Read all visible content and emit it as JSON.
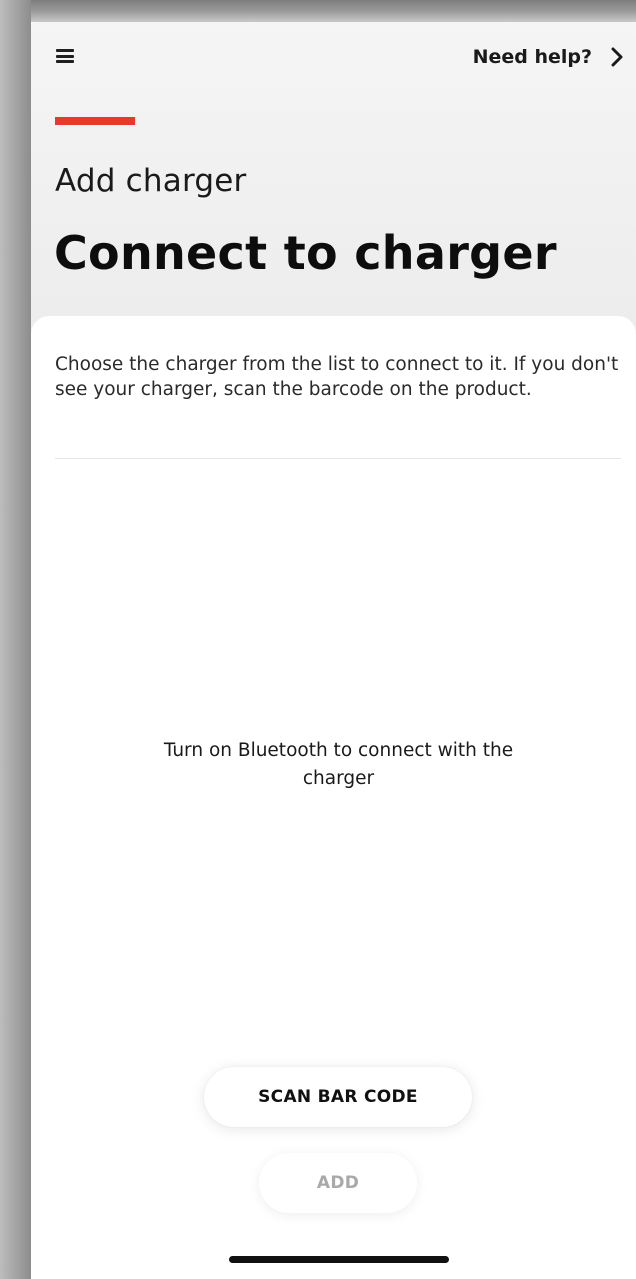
{
  "header": {
    "help_label": "Need help?"
  },
  "page": {
    "subtitle": "Add charger",
    "title": "Connect to charger"
  },
  "content": {
    "description": "Choose the charger from the list to connect to it. If you don't see your charger, scan the barcode on the product.",
    "bluetooth_message": "Turn on Bluetooth to connect with the charger"
  },
  "actions": {
    "scan_label": "SCAN BAR CODE",
    "add_label": "ADD"
  },
  "colors": {
    "accent": "#e8372c",
    "text_primary": "#1a1a1a",
    "disabled": "#a9a9a9",
    "card_background": "#ffffff"
  },
  "icons": {
    "menu": "menu-icon",
    "help_arrow": "chevron-right-icon"
  }
}
